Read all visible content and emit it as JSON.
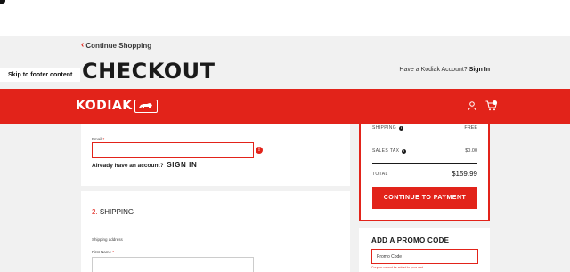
{
  "nav": {
    "continue_shopping": "Continue Shopping",
    "skip_to_footer": "Skip to footer content"
  },
  "page": {
    "title": "CHECKOUT",
    "account_question": "Have a Kodiak Account?",
    "account_signin": "Sign In"
  },
  "header": {
    "logo_text": "KODIAK",
    "cart_count": "0",
    "icons": [
      "user-icon",
      "cart-icon"
    ]
  },
  "email_section": {
    "label": "Email",
    "required_mark": "*",
    "value": "",
    "error_icon": "!",
    "already_text": "Already have an account?",
    "sign_in_label": "SIGN IN"
  },
  "shipping_section": {
    "step_number": "2.",
    "title": "SHIPPING",
    "address_label": "Shipping address",
    "first_name_label": "First Name",
    "required_mark": "*"
  },
  "summary": {
    "shipping_label": "SHIPPING",
    "shipping_value": "FREE",
    "tax_label": "SALES TAX",
    "tax_value": "$0.00",
    "total_label": "TOTAL",
    "total_value": "$159.99",
    "info_glyph": "i",
    "pay_button": "CONTINUE TO PAYMENT"
  },
  "promo": {
    "title": "ADD A PROMO CODE",
    "placeholder": "Promo Code",
    "error": "Coupon cannot be added to your cart"
  },
  "colors": {
    "brand_red": "#e2231a",
    "background_gray": "#f1f1f1",
    "text_dark": "#1a1a1a"
  }
}
